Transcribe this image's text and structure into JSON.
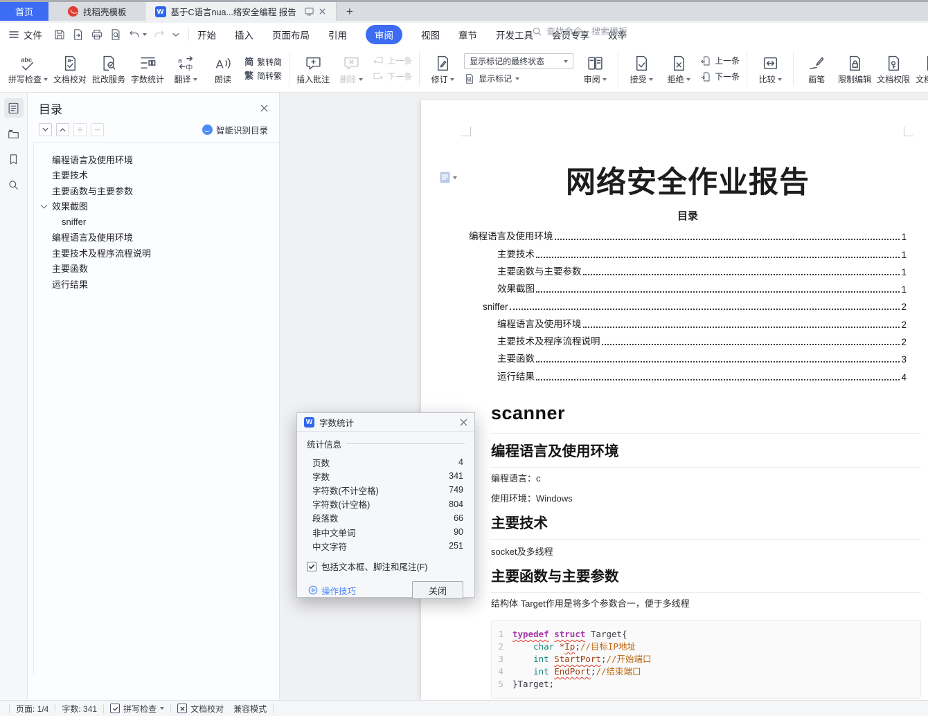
{
  "colors": {
    "accent": "#3b6cf3",
    "docer_red": "#e23d32",
    "page_bg": "#f0f1f3",
    "code_kw": "#a435a8",
    "code_ty": "#0f8578",
    "code_id": "#9c3c10",
    "code_cm": "#bc670f",
    "squiggle": "#e23b2e"
  },
  "window": {
    "wps_badge": "W",
    "new_tab": "+",
    "tabs": {
      "home": "首页",
      "docer": "找稻壳模板",
      "document": "基于C语言nua...络安全编程 报告"
    }
  },
  "menubar": {
    "file_label": "文件",
    "tabs": [
      "开始",
      "插入",
      "页面布局",
      "引用",
      "审阅",
      "视图",
      "章节",
      "开发工具",
      "会员专享",
      "效率"
    ],
    "active_tab": "审阅",
    "search_placeholder": "查找命令、搜索模板"
  },
  "ribbon": {
    "spell": "拼写检查",
    "proofread": "文档校对",
    "grading": "批改服务",
    "word_count": "字数统计",
    "translate": "翻译",
    "read_aloud": "朗读",
    "t2s": "繁转简",
    "s2t": "简转繁",
    "t2s_icon": "简",
    "s2t_icon": "繁",
    "insert_comment": "插入批注",
    "delete": "删除",
    "prev_comment": "上一条",
    "next_comment": "下一条",
    "revise": "修订",
    "markup_state": "显示标记的最终状态",
    "show_markup": "显示标记",
    "review": "审阅",
    "accept": "接受",
    "reject": "拒绝",
    "prev_change": "上一条",
    "next_change": "下一条",
    "compare": "比较",
    "ink": "画笔",
    "restrict_editing": "限制编辑",
    "doc_permissions": "文档权限",
    "doc_certify": "文档认证",
    "clipped": "文档"
  },
  "sidebar": {
    "panel_title": "目录",
    "smart_label": "智能识别目录",
    "items": [
      {
        "text": "编程语言及使用环境",
        "indent": 26
      },
      {
        "text": "主要技术",
        "indent": 26
      },
      {
        "text": "主要函数与主要参数",
        "indent": 26
      },
      {
        "text": "效果截图",
        "indent": 26,
        "arrow": true
      },
      {
        "text": "sniffer",
        "indent": 40
      },
      {
        "text": "编程语言及使用环境",
        "indent": 26
      },
      {
        "text": "主要技术及程序流程说明",
        "indent": 26
      },
      {
        "text": "主要函数",
        "indent": 26
      },
      {
        "text": "运行结果",
        "indent": 26
      }
    ]
  },
  "document": {
    "title": "网络安全作业报告",
    "toc_heading": "目录",
    "toc": [
      {
        "text": "编程语言及使用环境",
        "page": "1",
        "indent": 0
      },
      {
        "text": "主要技术",
        "page": "1",
        "indent": 41
      },
      {
        "text": "主要函数与主要参数",
        "page": "1",
        "indent": 41
      },
      {
        "text": "效果截图",
        "page": "1",
        "indent": 41
      },
      {
        "text": "sniffer",
        "page": "2",
        "indent": 20
      },
      {
        "text": "编程语言及使用环境",
        "page": "2",
        "indent": 41
      },
      {
        "text": "主要技术及程序流程说明",
        "page": "2",
        "indent": 41
      },
      {
        "text": "主要函数",
        "page": "3",
        "indent": 41
      },
      {
        "text": "运行结果",
        "page": "4",
        "indent": 41
      }
    ],
    "h1": "scanner",
    "sections": [
      {
        "heading": "编程语言及使用环境",
        "paras": [
          "编程语言：c",
          "使用环境：Windows"
        ]
      },
      {
        "heading": "主要技术",
        "paras": [
          "socket及多线程"
        ]
      },
      {
        "heading": "主要函数与主要参数",
        "paras": [
          "结构体 Target作用是将多个参数合一，便于多线程"
        ]
      }
    ],
    "code": {
      "lines": [
        {
          "n": "1",
          "tokens": [
            [
              "kw",
              "typedef",
              true
            ],
            [
              "pl",
              " "
            ],
            [
              "kw",
              "struct",
              true
            ],
            [
              "pl",
              " "
            ],
            [
              "pl",
              "Target{"
            ]
          ]
        },
        {
          "n": "2",
          "tokens": [
            [
              "pl",
              "    "
            ],
            [
              "ty",
              "char"
            ],
            [
              "pl",
              " "
            ],
            [
              "id",
              "*"
            ],
            [
              "id",
              "Ip",
              true
            ],
            [
              "pl",
              ";"
            ],
            [
              "cm",
              "//目标IP地址"
            ]
          ]
        },
        {
          "n": "3",
          "tokens": [
            [
              "pl",
              "    "
            ],
            [
              "ty",
              "int"
            ],
            [
              "pl",
              " "
            ],
            [
              "id",
              "StartPort",
              true
            ],
            [
              "pl",
              ";"
            ],
            [
              "cm",
              "//开始端口"
            ]
          ]
        },
        {
          "n": "4",
          "tokens": [
            [
              "pl",
              "    "
            ],
            [
              "ty",
              "int"
            ],
            [
              "pl",
              " "
            ],
            [
              "id",
              "EndPort",
              true
            ],
            [
              "pl",
              ";"
            ],
            [
              "cm",
              "//结束端口"
            ]
          ]
        },
        {
          "n": "5",
          "tokens": [
            [
              "pl",
              "}Target;"
            ]
          ]
        }
      ]
    }
  },
  "wordcount_dialog": {
    "title": "字数统计",
    "group": "统计信息",
    "rows": [
      [
        "页数",
        "4"
      ],
      [
        "字数",
        "341"
      ],
      [
        "字符数(不计空格)",
        "749"
      ],
      [
        "字符数(计空格)",
        "804"
      ],
      [
        "段落数",
        "66"
      ],
      [
        "非中文单词",
        "90"
      ],
      [
        "中文字符",
        "251"
      ]
    ],
    "checkbox_label": "包括文本框、脚注和尾注(F)",
    "checkbox_checked": true,
    "tips_link": "操作技巧",
    "close_button": "关闭"
  },
  "statusbar": {
    "page": "页面: 1/4",
    "words": "字数: 341",
    "spell": "拼写检查",
    "proof": "文档校对",
    "compat": "兼容模式"
  }
}
